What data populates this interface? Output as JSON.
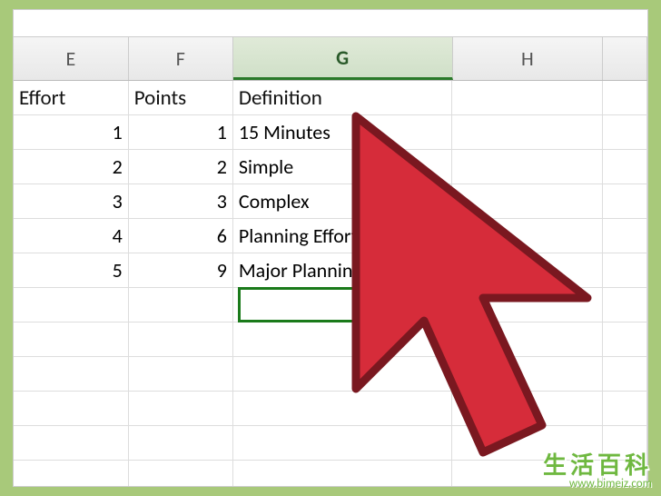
{
  "columns": [
    "E",
    "F",
    "G",
    "H"
  ],
  "selected_column": "G",
  "headers": {
    "E": "Effort",
    "F": "Points",
    "G": "Definition",
    "H": ""
  },
  "rows": [
    {
      "E": "1",
      "F": "1",
      "G": "15 Minutes"
    },
    {
      "E": "2",
      "F": "2",
      "G": "Simple"
    },
    {
      "E": "3",
      "F": "3",
      "G": "Complex"
    },
    {
      "E": "4",
      "F": "6",
      "G": "Planning Effort"
    },
    {
      "E": "5",
      "F": "9",
      "G": "Major Planning Effort"
    }
  ],
  "selected_cell": {
    "col": "G",
    "row_index": 6
  },
  "watermark": {
    "title": "生活百科",
    "url": "www.bimeiz.com"
  }
}
